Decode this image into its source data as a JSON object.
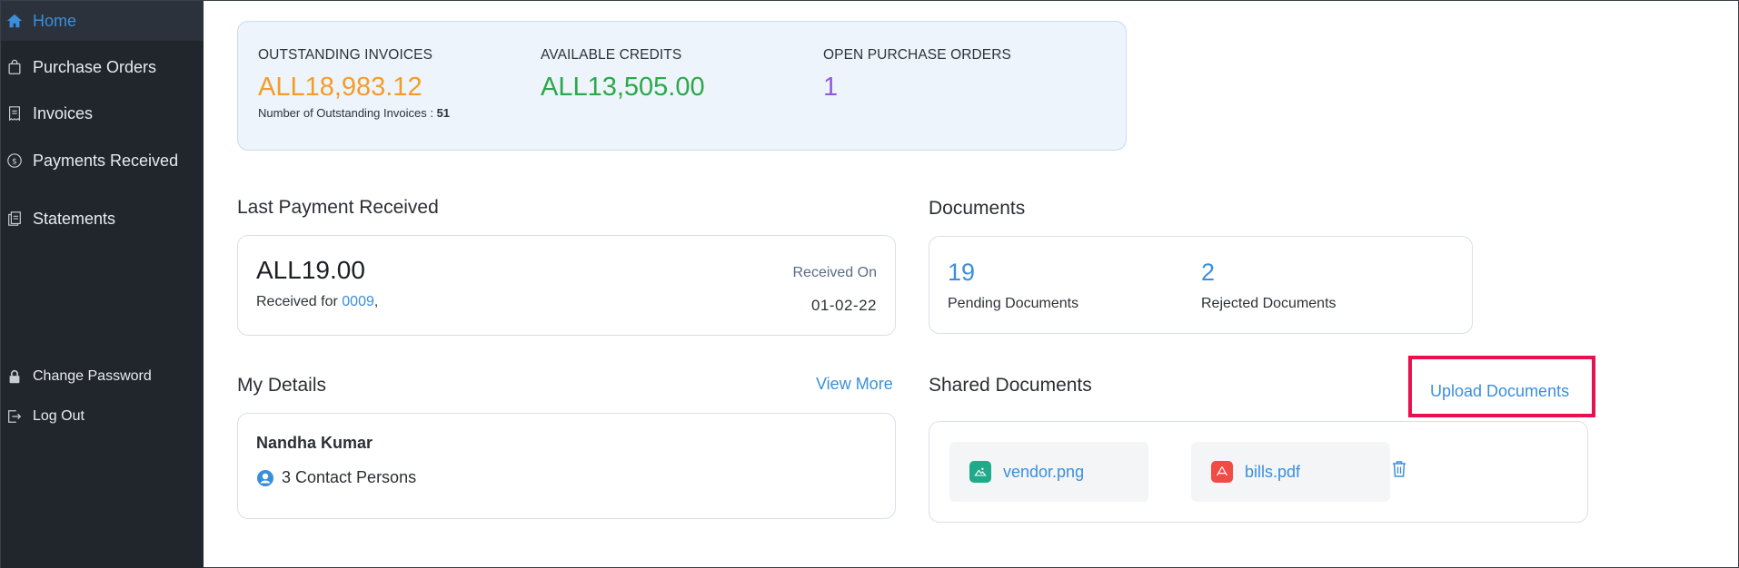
{
  "sidebar": {
    "items": [
      {
        "label": "Home",
        "icon": "home-icon"
      },
      {
        "label": "Purchase Orders",
        "icon": "shopping-bag-icon"
      },
      {
        "label": "Invoices",
        "icon": "receipt-icon"
      },
      {
        "label": "Payments Received",
        "icon": "dollar-circle-icon"
      },
      {
        "label": "Statements",
        "icon": "document-copy-icon"
      }
    ],
    "bottom_items": [
      {
        "label": "Change Password",
        "icon": "lock-icon"
      },
      {
        "label": "Log Out",
        "icon": "logout-icon"
      }
    ]
  },
  "summary": {
    "outstanding_label": "OUTSTANDING INVOICES",
    "outstanding_value": "ALL18,983.12",
    "outstanding_count_label": "Number of Outstanding Invoices :",
    "outstanding_count": "51",
    "credits_label": "AVAILABLE CREDITS",
    "credits_value": "ALL13,505.00",
    "po_label": "OPEN PURCHASE ORDERS",
    "po_value": "1"
  },
  "last_payment": {
    "title": "Last Payment Received",
    "amount": "ALL19.00",
    "received_for_label": "Received for",
    "received_for_link": "0009",
    "received_for_suffix": ",",
    "received_on_label": "Received On",
    "received_on_date": "01-02-22"
  },
  "documents": {
    "title": "Documents",
    "pending_count": "19",
    "pending_label": "Pending Documents",
    "rejected_count": "2",
    "rejected_label": "Rejected Documents"
  },
  "my_details": {
    "title": "My Details",
    "view_more": "View More",
    "name": "Nandha Kumar",
    "contacts": "3 Contact Persons"
  },
  "shared_documents": {
    "title": "Shared Documents",
    "upload_label": "Upload Documents",
    "files": [
      {
        "name": "vendor.png",
        "icon": "image-file-icon"
      },
      {
        "name": "bills.pdf",
        "icon": "pdf-file-icon"
      }
    ]
  },
  "colors": {
    "sidebar_bg": "#21262d",
    "accent_blue": "#3a8fdc",
    "outstanding_orange": "#f39c28",
    "credits_green": "#2ba84a",
    "po_purple": "#8e5bd6",
    "highlight_red": "#e8104e",
    "png_icon_teal": "#1faa89",
    "pdf_icon_red": "#f04b45"
  }
}
